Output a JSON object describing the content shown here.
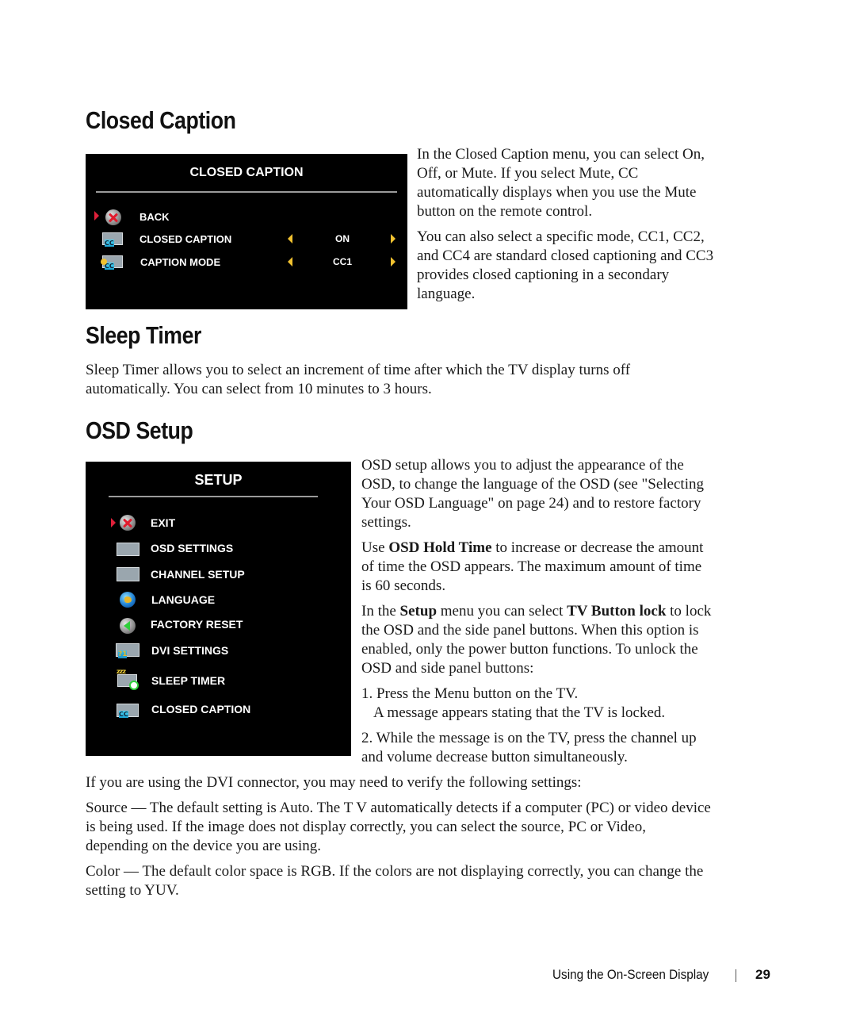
{
  "sections": {
    "closed_caption": {
      "heading": "Closed Caption",
      "osd": {
        "title": "CLOSED CAPTION",
        "items": [
          {
            "icon": "back-x-icon",
            "label": "BACK",
            "selected": true
          },
          {
            "icon": "cc-tv-icon",
            "label": "CLOSED CAPTION",
            "value": "ON"
          },
          {
            "icon": "cc-mode-icon",
            "label": "CAPTION MODE",
            "value": "CC1"
          }
        ],
        "cc_icon_text": "CC"
      },
      "paragraphs": [
        "In the Closed Caption menu, you can select On, Off, or Mute. If you select Mute, CC automatically displays when you use the Mute button on the remote control.",
        "You can also select a specific mode, CC1, CC2, and CC4 are standard closed captioning and CC3 provides closed captioning in a secondary language."
      ]
    },
    "sleep_timer": {
      "heading": "Sleep Timer",
      "para_bold": "Sleep Timer",
      "para_rest": " allows you to select an increment of time after which the TV display turns off automatically. You can select from 10 minutes to 3 hours."
    },
    "osd_setup": {
      "heading": "OSD Setup",
      "osd": {
        "title": "SETUP",
        "items": [
          {
            "icon": "exit-x-icon",
            "label": "EXIT",
            "selected": true
          },
          {
            "icon": "osd-settings-icon",
            "label": "OSD SETTINGS"
          },
          {
            "icon": "channel-setup-icon",
            "label": "CHANNEL SETUP"
          },
          {
            "icon": "globe-icon",
            "label": "LANGUAGE"
          },
          {
            "icon": "factory-reset-icon",
            "label": "FACTORY RESET"
          },
          {
            "icon": "dvi-settings-icon",
            "label": "DVI SETTINGS"
          },
          {
            "icon": "sleep-timer-icon",
            "label": "SLEEP TIMER"
          },
          {
            "icon": "closed-caption-icon",
            "label": "CLOSED CAPTION"
          }
        ],
        "dvi_icon_text": "?1",
        "zzz_text": "zzz"
      },
      "p1": "OSD setup allows you to adjust the appearance of the OSD, to change the language of the OSD (see \"Selecting Your OSD Language\" on page 24) and to restore factory settings.",
      "p2_pre": "Use ",
      "p2_bold": "OSD Hold Time",
      "p2_post": " to increase or decrease the amount of time the OSD appears. The maximum amount of time is 60 seconds.",
      "p3_a": "In the ",
      "p3_b": "Setup",
      "p3_c": " menu you can select ",
      "p3_d": "TV Button lock",
      "p3_e": " to lock the OSD and the side panel buttons. When this option is enabled, only the power button functions. To unlock the OSD and side panel buttons:",
      "step1": "1. Press the Menu button on the TV.",
      "step1_note": "A message appears stating that the TV is locked.",
      "step2": "2. While the message is on the TV, press the channel up and volume decrease button simultaneously."
    },
    "dvi": {
      "intro": "If you are using the DVI connector, you may need to verify the following settings:",
      "source_label": "Source",
      "source_text": " — The default setting is Auto. The T V automatically detects if a computer (PC) or video device is   being used. If the image does not display correctly, you can select the source, ",
      "source_pc": "PC",
      "source_or": " or ",
      "source_video": "Video",
      "source_end": ", depending on the device   you are using.",
      "color_label": "Color",
      "color_text": " — The default color space is ",
      "color_rgb": "RGB",
      "color_text2": ". If the colors are not displaying correctly, you can change the setting to ",
      "color_yuv": "YUV",
      "color_end": "."
    }
  },
  "footer": {
    "chapter": "Using the On-Screen Display",
    "page": "29"
  }
}
